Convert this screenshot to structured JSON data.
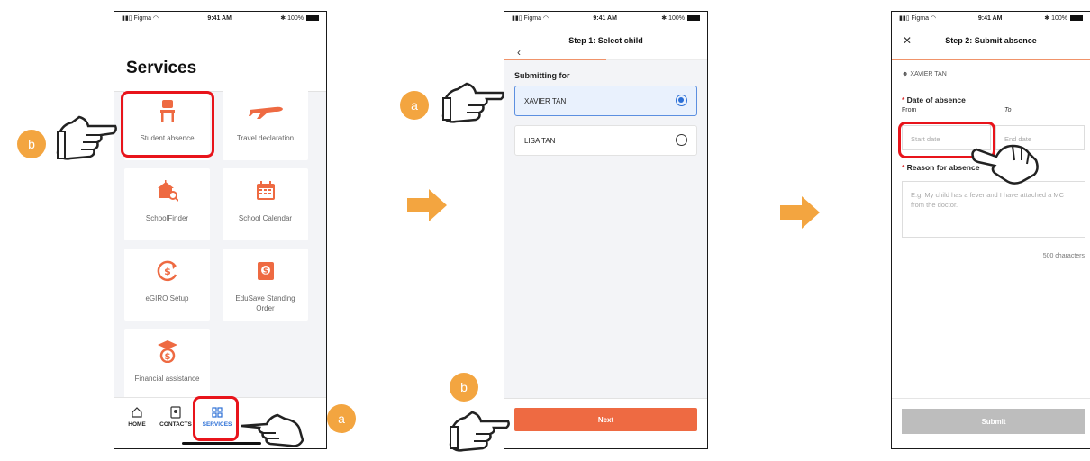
{
  "status_bar": {
    "carrier": "Figma",
    "time": "9:41 AM",
    "battery": "100%"
  },
  "screen1": {
    "title": "Services",
    "tiles": [
      {
        "label": "Student absence",
        "icon": "chair-icon"
      },
      {
        "label": "Travel declaration",
        "icon": "airplane-icon"
      },
      {
        "label": "SchoolFinder",
        "icon": "school-search-icon"
      },
      {
        "label": "School Calendar",
        "icon": "calendar-icon"
      },
      {
        "label": "eGIRO Setup",
        "icon": "dollar-refresh-icon"
      },
      {
        "label": "EduSave Standing Order",
        "icon": "money-book-icon"
      },
      {
        "label": "Financial assistance",
        "icon": "graduation-money-icon"
      }
    ],
    "nav": [
      {
        "label": "HOME",
        "icon": "home-icon"
      },
      {
        "label": "CONTACTS",
        "icon": "contacts-icon"
      },
      {
        "label": "SERVICES",
        "icon": "grid-icon"
      }
    ]
  },
  "screen2": {
    "title": "Step 1: Select child",
    "section": "Submitting for",
    "children": [
      {
        "name": "XAVIER TAN",
        "selected": true
      },
      {
        "name": "LISA TAN",
        "selected": false
      }
    ],
    "next_label": "Next"
  },
  "screen3": {
    "title": "Step 2: Submit absence",
    "child": "XAVIER TAN",
    "date_label": "Date of absence",
    "from_label": "From",
    "to_label": "To",
    "start_placeholder": "Start date",
    "end_placeholder": "End date",
    "reason_label": "Reason for absence",
    "reason_placeholder": "E.g. My child has a fever and I have attached a MC from the doctor.",
    "char_count": "500 characters",
    "submit_label": "Submit"
  },
  "annotations": {
    "a": "a",
    "b": "b"
  },
  "colors": {
    "accent": "#ee6a42",
    "highlight": "#e8141b",
    "badge": "#f3a540",
    "selected": "#2b6fd6"
  }
}
